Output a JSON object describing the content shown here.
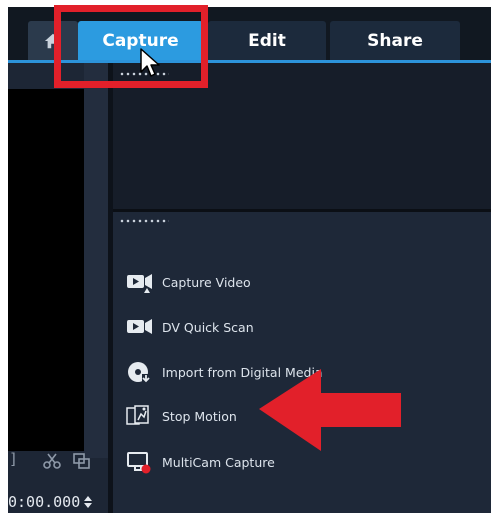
{
  "tabs": {
    "home_icon": "home-icon",
    "capture": "Capture",
    "edit": "Edit",
    "share": "Share",
    "active": "Capture"
  },
  "left_panel": {
    "timecode": "0:00.000"
  },
  "capture_options": [
    {
      "label": "Capture Video",
      "icon": "capture-video-icon"
    },
    {
      "label": "DV Quick Scan",
      "icon": "dv-quick-scan-icon"
    },
    {
      "label": "Import from Digital Media",
      "icon": "import-digital-media-icon"
    },
    {
      "label": "Stop Motion",
      "icon": "stop-motion-icon"
    },
    {
      "label": "MultiCam Capture",
      "icon": "multicam-capture-icon"
    }
  ],
  "colors": {
    "accent": "#2c9be0",
    "annotation": "#e2202a",
    "background": "#1a2230"
  }
}
